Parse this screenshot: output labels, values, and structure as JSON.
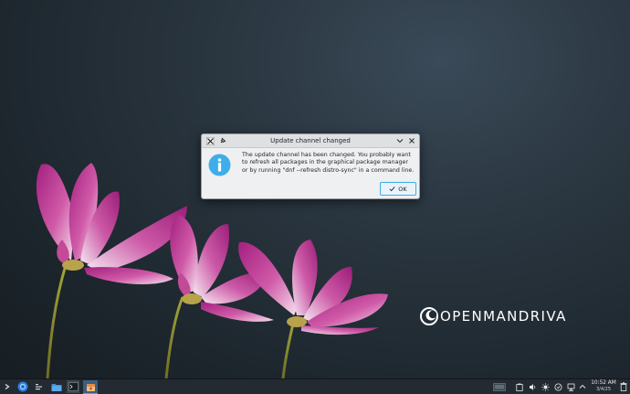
{
  "dialog": {
    "title": "Update channel changed",
    "message": "The update channel has been changed. You probably want to refresh all packages in the graphical package manager or by running \"dnf --refresh distro-sync\" in a command line.",
    "ok_label": "OK",
    "icons": [
      "x11-app-icon",
      "pin-icon",
      "chevron-down-icon",
      "close-icon",
      "information-icon",
      "checkmark-icon"
    ]
  },
  "desktop": {
    "logo_text": "OPENMANDRIVA",
    "wallpaper": "pink-cosmos-flowers"
  },
  "taskbar": {
    "launchers": [
      "application-launcher-icon",
      "browser-icon",
      "task-manager-icon",
      "file-manager-icon",
      "terminal-icon",
      "software-center-icon"
    ],
    "tray_icons": [
      "virtual-desktop-pager",
      "clipboard-icon",
      "volume-icon",
      "brightness-icon",
      "update-icon",
      "network-icon",
      "expand-tray-icon"
    ],
    "clock": {
      "time": "10:52 AM",
      "date": "3/4/25"
    }
  },
  "colors": {
    "accent": "#3daee9",
    "dialog_bg": "#eff0f1",
    "taskbar_bg": "#232a31"
  }
}
